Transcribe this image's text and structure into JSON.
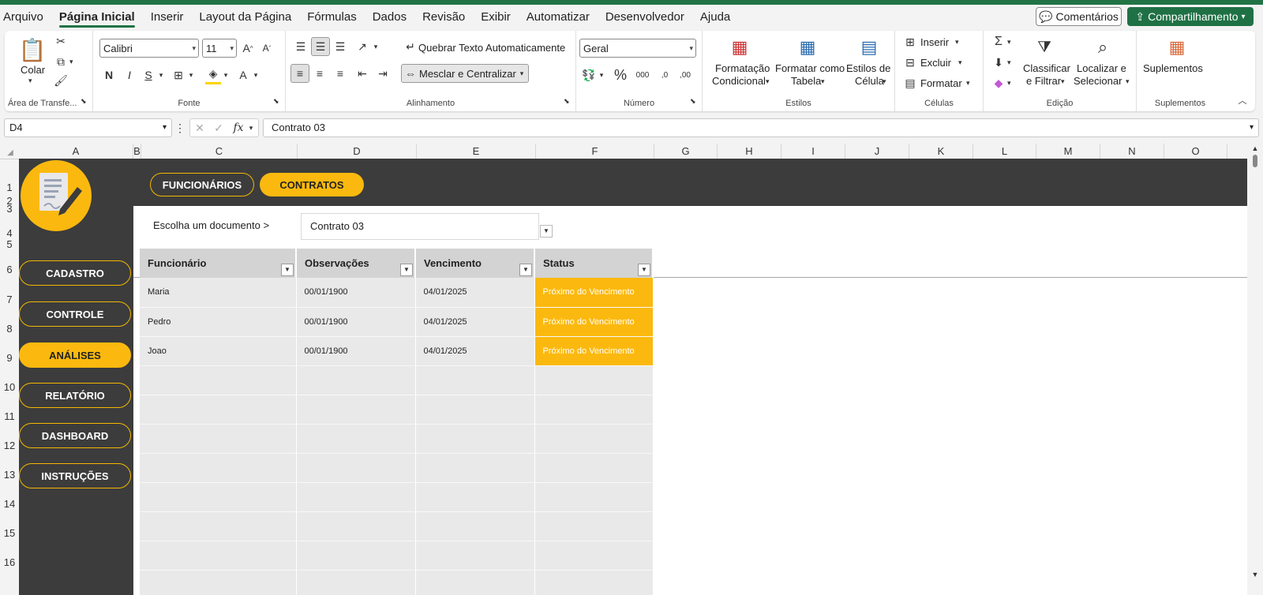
{
  "menu": [
    "Arquivo",
    "Página Inicial",
    "Inserir",
    "Layout da Página",
    "Fórmulas",
    "Dados",
    "Revisão",
    "Exibir",
    "Automatizar",
    "Desenvolvedor",
    "Ajuda"
  ],
  "buttons": {
    "comments": "Comentários",
    "share": "Compartilhamento"
  },
  "ribbon": {
    "clipboard": {
      "paste": "Colar",
      "label": "Área de Transfe..."
    },
    "font": {
      "name": "Calibri",
      "size": "11",
      "label": "Fonte"
    },
    "alignment": {
      "wrap": "Quebrar Texto Automaticamente",
      "merge": "Mesclar e Centralizar",
      "label": "Alinhamento"
    },
    "number": {
      "format": "Geral",
      "label": "Número"
    },
    "styles": {
      "cond1": "Formatação",
      "cond2": "Condicional",
      "table1": "Formatar como",
      "table2": "Tabela",
      "cell1": "Estilos de",
      "cell2": "Célula",
      "label": "Estilos"
    },
    "cells": {
      "insert": "Inserir",
      "delete": "Excluir",
      "format": "Formatar",
      "label": "Células"
    },
    "editing": {
      "sort1": "Classificar",
      "sort2": "e Filtrar",
      "find1": "Localizar e",
      "find2": "Selecionar",
      "label": "Edição"
    },
    "addins": {
      "btn": "Suplementos",
      "label": "Suplementos"
    }
  },
  "formula": {
    "cell": "D4",
    "value": "Contrato 03"
  },
  "columns": [
    "A",
    "B",
    "C",
    "D",
    "E",
    "F",
    "G",
    "H",
    "I",
    "J",
    "K",
    "L",
    "M",
    "N",
    "O"
  ],
  "rows": [
    "1",
    "2",
    "3",
    "4",
    "5",
    "6",
    "7",
    "8",
    "9",
    "10",
    "11",
    "12",
    "13",
    "14",
    "15",
    "16"
  ],
  "sheet": {
    "tabs": [
      "FUNCIONÁRIOS",
      "CONTRATOS"
    ],
    "nav": [
      "CADASTRO",
      "CONTROLE",
      "ANÁLISES",
      "RELATÓRIO",
      "DASHBOARD",
      "INSTRUÇÕES"
    ],
    "doc_label": "Escolha um documento >",
    "doc_value": "Contrato 03",
    "headers": [
      "Funcionário",
      "Observações",
      "Vencimento",
      "Status"
    ],
    "records": [
      {
        "name": "Maria",
        "obs": "00/01/1900",
        "due": "04/01/2025",
        "status": "Próximo do Vencimento"
      },
      {
        "name": "Pedro",
        "obs": "00/01/1900",
        "due": "04/01/2025",
        "status": "Próximo do Vencimento"
      },
      {
        "name": "Joao",
        "obs": "00/01/1900",
        "due": "04/01/2025",
        "status": "Próximo do Vencimento"
      }
    ]
  },
  "colors": {
    "accent": "#fbb90f",
    "dark": "#3c3c3c",
    "excel_green": "#217346"
  }
}
